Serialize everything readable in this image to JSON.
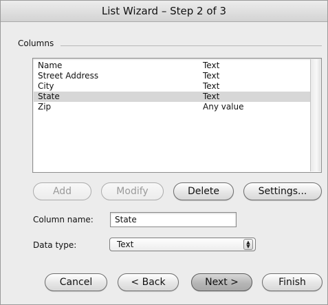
{
  "window": {
    "title": "List Wizard – Step 2 of 3"
  },
  "columns_group": {
    "label": "Columns"
  },
  "columns_list": {
    "rows": [
      {
        "name": "Name",
        "type": "Text"
      },
      {
        "name": "Street Address",
        "type": "Text"
      },
      {
        "name": "City",
        "type": "Text"
      },
      {
        "name": "State",
        "type": "Text",
        "selected": true
      },
      {
        "name": "Zip",
        "type": "Any value"
      }
    ]
  },
  "list_buttons": {
    "add": "Add",
    "modify": "Modify",
    "delete": "Delete",
    "settings": "Settings..."
  },
  "column_name": {
    "label": "Column name:",
    "value": "State"
  },
  "data_type": {
    "label": "Data type:",
    "value": "Text",
    "icon": "popup-arrows-icon"
  },
  "footer_buttons": {
    "cancel": "Cancel",
    "back": "< Back",
    "next": "Next >",
    "finish": "Finish"
  },
  "colors": {
    "window_bg": "#ececec",
    "selection": "#d7d7d7"
  }
}
